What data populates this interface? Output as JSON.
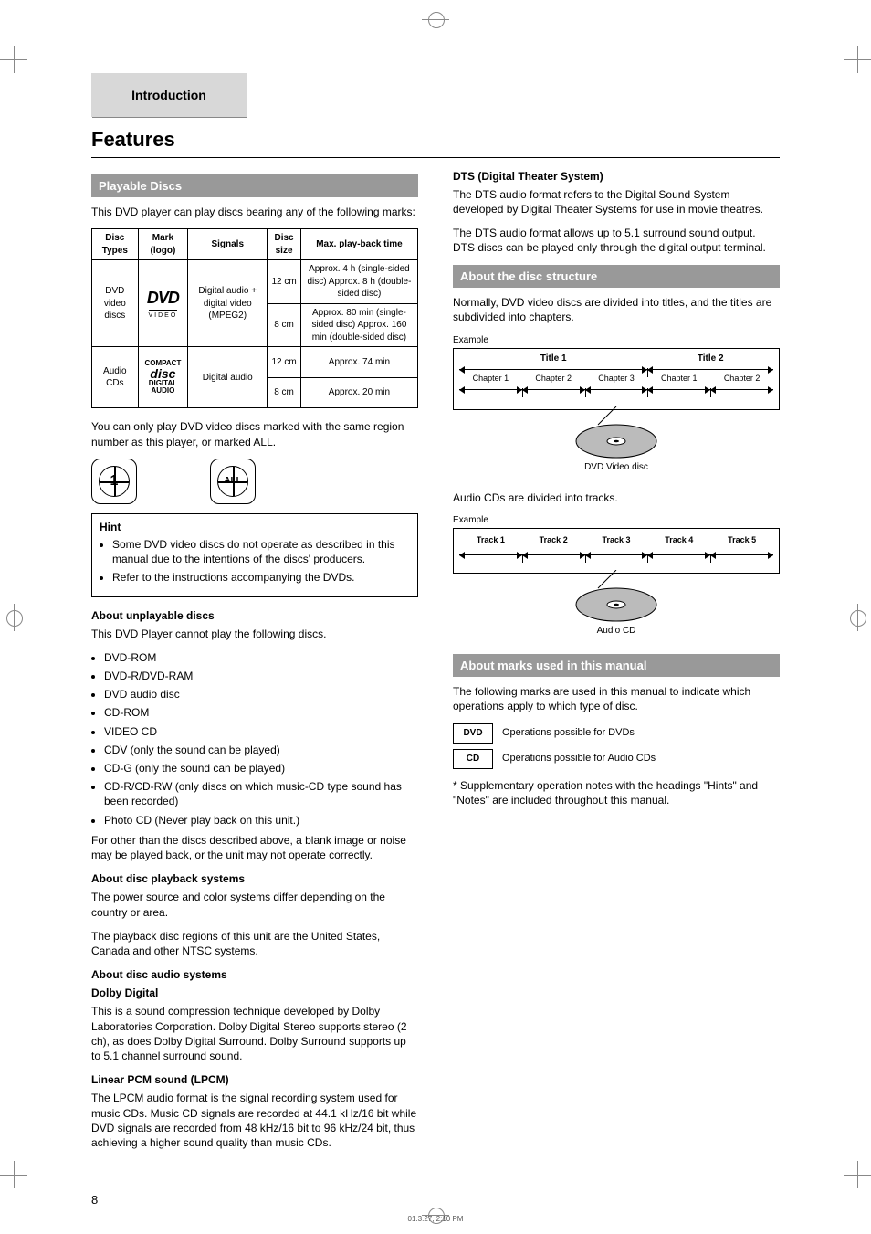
{
  "section_tab": "Introduction",
  "page_title": "Features",
  "left": {
    "subhead": "Playable Discs",
    "intro": "This DVD player can play discs bearing any of the following marks:",
    "table": {
      "headers": [
        "Disc Types",
        "Mark (logo)",
        "Signals",
        "Disc size",
        "Max. play-back time"
      ],
      "rows": [
        {
          "type": "DVD video discs",
          "mark": {
            "logo": "DVD",
            "sub": "VIDEO"
          },
          "signals": "Digital audio + digital video (MPEG2)",
          "sizes": [
            {
              "size": "12 cm",
              "play": "Approx. 4 h (single-sided disc) Approx. 8 h (double-sided disc)"
            },
            {
              "size": "8 cm",
              "play": "Approx. 80 min (single-sided disc) Approx. 160 min (double-sided disc)"
            }
          ]
        },
        {
          "type": "Audio CDs",
          "mark": {
            "top": "COMPACT",
            "mid": "disc",
            "sub": "DIGITAL AUDIO"
          },
          "signals": "Digital audio",
          "sizes": [
            {
              "size": "12 cm",
              "play": "Approx. 74 min"
            },
            {
              "size": "8 cm",
              "play": "Approx. 20 min"
            }
          ]
        }
      ]
    },
    "region_note": "You can only play DVD video discs marked with the same region number as this player, or marked ALL.",
    "region1": "1",
    "region_all": "ALL",
    "hint": {
      "title": "Hint",
      "lines": [
        "Some DVD video discs do not operate as described in this manual due to the intentions of the discs' producers.",
        "Refer to the instructions accompanying the DVDs."
      ]
    },
    "unplayable": {
      "heading": "About unplayable discs",
      "text1": "This DVD Player cannot play the following discs.",
      "items": [
        "DVD-ROM",
        "DVD-R/DVD-RAM",
        "DVD audio disc",
        "CD-ROM",
        "VIDEO CD",
        "CDV (only the sound can be played)",
        "CD-G (only the sound can be played)",
        "CD-R/CD-RW (only discs on which music-CD type sound has been recorded)",
        "Photo CD (Never play back on this unit.)"
      ],
      "text2": "For other than the discs described above, a blank image or noise may be played back, or the unit may not operate correctly."
    },
    "playback_systems": {
      "heading": "About disc playback systems",
      "text1": "The power source and color systems differ depending on the country or area.",
      "text2": "The playback disc regions of this unit are the United States, Canada and other NTSC systems."
    },
    "audio_systems": {
      "heading": "About disc audio systems",
      "dolby": {
        "label": "Dolby Digital",
        "text": "This is a sound compression technique developed by Dolby Laboratories Corporation. Dolby Digital Stereo supports stereo (2 ch), as does Dolby Digital Surround. Dolby Surround supports up to 5.1 channel surround sound."
      },
      "lpcm": {
        "label": "Linear PCM sound (LPCM)",
        "text": "The LPCM audio format is the signal recording system used for music CDs. Music CD signals are recorded at 44.1 kHz/16 bit while DVD signals are recorded from 48 kHz/16 bit to 96 kHz/24 bit, thus achieving a higher sound quality than music CDs."
      }
    }
  },
  "right": {
    "dts": {
      "label": "DTS (Digital Theater System)",
      "text1": "The DTS audio format refers to the Digital Sound System developed by Digital Theater Systems for use in movie theatres.",
      "text2": "The DTS audio format allows up to 5.1 surround sound output. DTS discs can be played only through the digital output terminal."
    },
    "subhead_structure": "About the disc structure",
    "dvd_structure": {
      "intro": "Normally, DVD video discs are divided into titles, and the titles are subdivided into chapters.",
      "title_row": [
        "Title 1",
        "Title 2"
      ],
      "chap_row": [
        "Chapter 1",
        "Chapter 2",
        "Chapter 3",
        "Chapter 1",
        "Chapter 2"
      ],
      "caption": "Example",
      "disc_label": "DVD Video disc"
    },
    "cd_structure": {
      "intro": "Audio CDs are divided into tracks.",
      "tracks": [
        "Track 1",
        "Track 2",
        "Track 3",
        "Track 4",
        "Track 5"
      ],
      "caption": "Example",
      "disc_label": "Audio CD"
    },
    "subhead_marks": "About marks used in this manual",
    "marks_intro": "The following marks are used in this manual to indicate which operations apply to which type of disc.",
    "dvd_mark": {
      "label": "DVD",
      "text": "Operations possible for DVDs"
    },
    "cd_mark": {
      "label": "CD",
      "text": "Operations possible for Audio CDs"
    },
    "supplementary": "* Supplementary operation notes with the headings \"Hints\" and \"Notes\" are included throughout this manual."
  },
  "page_number": "8",
  "footer": "01.3.27, 2:10 PM"
}
